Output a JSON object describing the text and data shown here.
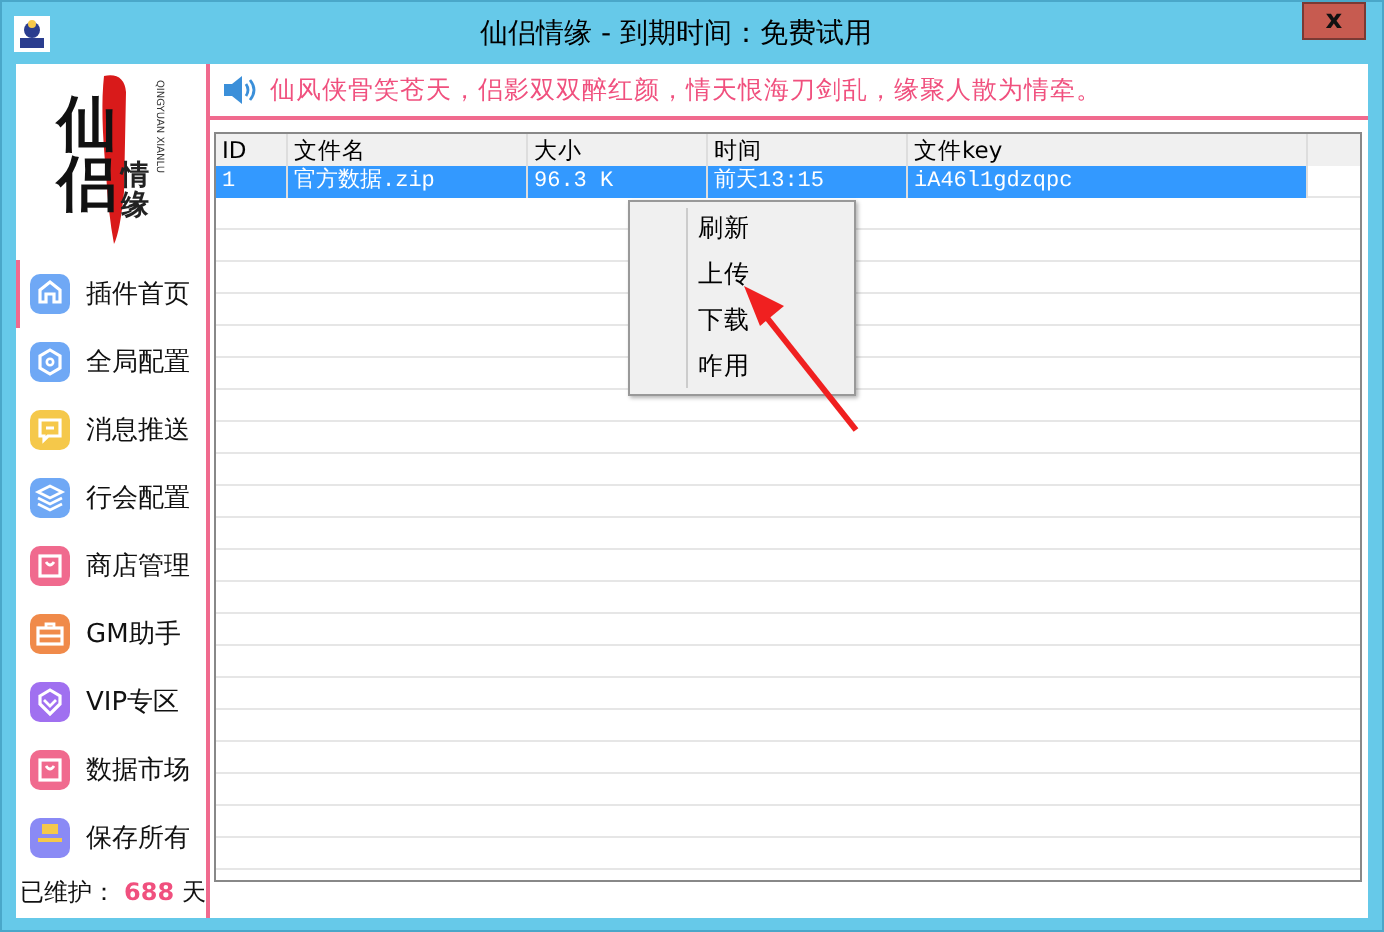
{
  "window": {
    "title": "仙侣情缘 - 到期时间：免费试用",
    "close": "x"
  },
  "logo": {
    "big": [
      "仙",
      "侣"
    ],
    "small": "情缘",
    "latin": "QINGYUAN XIANLU"
  },
  "sidebar": {
    "items": [
      {
        "label": "插件首页",
        "color": "#6fa8f5",
        "selected": true
      },
      {
        "label": "全局配置",
        "color": "#6fa8f5",
        "selected": false
      },
      {
        "label": "消息推送",
        "color": "#f5c84a",
        "selected": false
      },
      {
        "label": "行会配置",
        "color": "#6fa8f5",
        "selected": false
      },
      {
        "label": "商店管理",
        "color": "#f06a8e",
        "selected": false
      },
      {
        "label": "GM助手",
        "color": "#f08a4a",
        "selected": false
      },
      {
        "label": "VIP专区",
        "color": "#a070f0",
        "selected": false
      },
      {
        "label": "数据市场",
        "color": "#f06a8e",
        "selected": false
      },
      {
        "label": "保存所有",
        "color": "#8a8af5",
        "selected": false
      }
    ],
    "footer": {
      "label": "已维护：",
      "count": "688",
      "unit": "天"
    }
  },
  "marquee": "仙风侠骨笑苍天，侣影双双醉红颜，情天恨海刀剑乱，缘聚人散为情牵。",
  "table": {
    "columns": [
      "ID",
      "文件名",
      "大小",
      "时间",
      "文件key"
    ],
    "rows": [
      {
        "cells": [
          "1",
          "官方数据.zip",
          "96.3 K",
          "前天13:15",
          "iA46l1gdzqpc"
        ],
        "selected": true
      }
    ]
  },
  "context_menu": {
    "items": [
      "刷新",
      "上传",
      "下载",
      "咋用"
    ]
  }
}
